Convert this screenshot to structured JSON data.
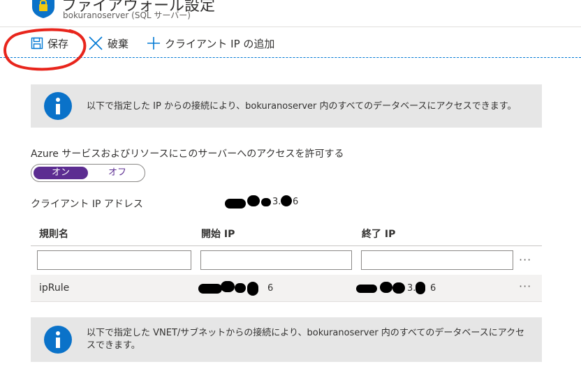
{
  "header": {
    "title": "ファイアウォール設定",
    "subtitle": "bokuranoserver (SQL サーバー)"
  },
  "toolbar": {
    "save_label": "保存",
    "discard_label": "破棄",
    "add_client_ip_label": "クライアント IP の追加"
  },
  "info_banner_top": {
    "text": "以下で指定した IP からの接続により、bokuranoserver 内のすべてのデータベースにアクセスできます。"
  },
  "azure_access": {
    "label": "Azure サービスおよびリソースにこのサーバーへのアクセスを許可する",
    "on_label": "オン",
    "off_label": "オフ",
    "selected": "オン"
  },
  "client_ip": {
    "label": "クライアント IP アドレス",
    "visible_fragment_1": "3.",
    "visible_fragment_2": "6"
  },
  "rules_table": {
    "columns": [
      "規則名",
      "開始 IP",
      "終了 IP"
    ],
    "new_row": {
      "name": "",
      "start_ip": "",
      "end_ip": ""
    },
    "rows": [
      {
        "name": "ipRule",
        "start_ip_fragment": "6",
        "end_ip_fragment_1": "3.",
        "end_ip_fragment_2": "6"
      }
    ],
    "more_label": "···"
  },
  "info_banner_bottom": {
    "text": "以下で指定した VNET/サブネットからの接続により、bokuranoserver 内のすべてのデータベースにアクセスできます。"
  },
  "colors": {
    "accent": "#0078d4",
    "toggle_on": "#5c2d91",
    "info_icon": "#0a72c9",
    "annotation": "#e8251c"
  }
}
